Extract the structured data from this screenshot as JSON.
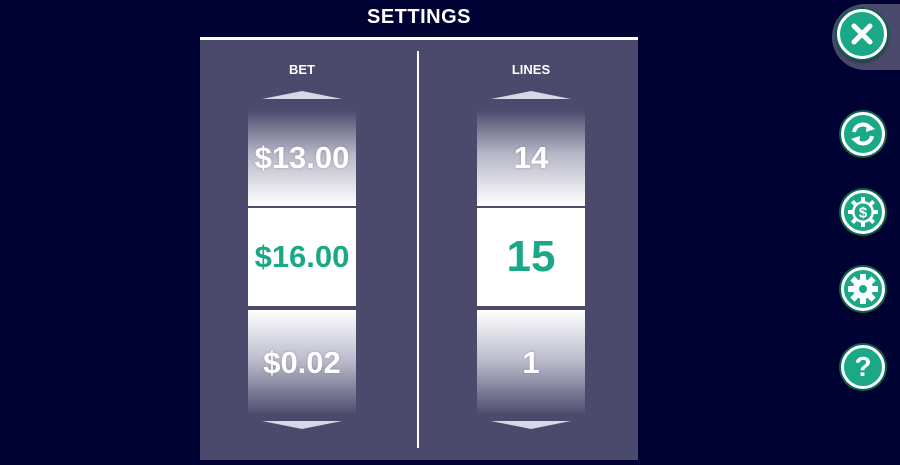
{
  "header": {
    "title": "SETTINGS"
  },
  "bet": {
    "label": "BET",
    "prev": "$13.00",
    "current": "$16.00",
    "next": "$0.02"
  },
  "lines": {
    "label": "LINES",
    "prev": "14",
    "current": "15",
    "next": "1"
  },
  "colors": {
    "background": "#000233",
    "panel": "#4b4a6c",
    "accent": "#1aa886",
    "text": "#ffffff"
  },
  "side_buttons": [
    {
      "icon": "close-icon"
    },
    {
      "icon": "refresh-icon"
    },
    {
      "icon": "bet-settings-icon"
    },
    {
      "icon": "gear-icon"
    },
    {
      "icon": "help-icon"
    }
  ],
  "help": {
    "glyph": "?"
  }
}
